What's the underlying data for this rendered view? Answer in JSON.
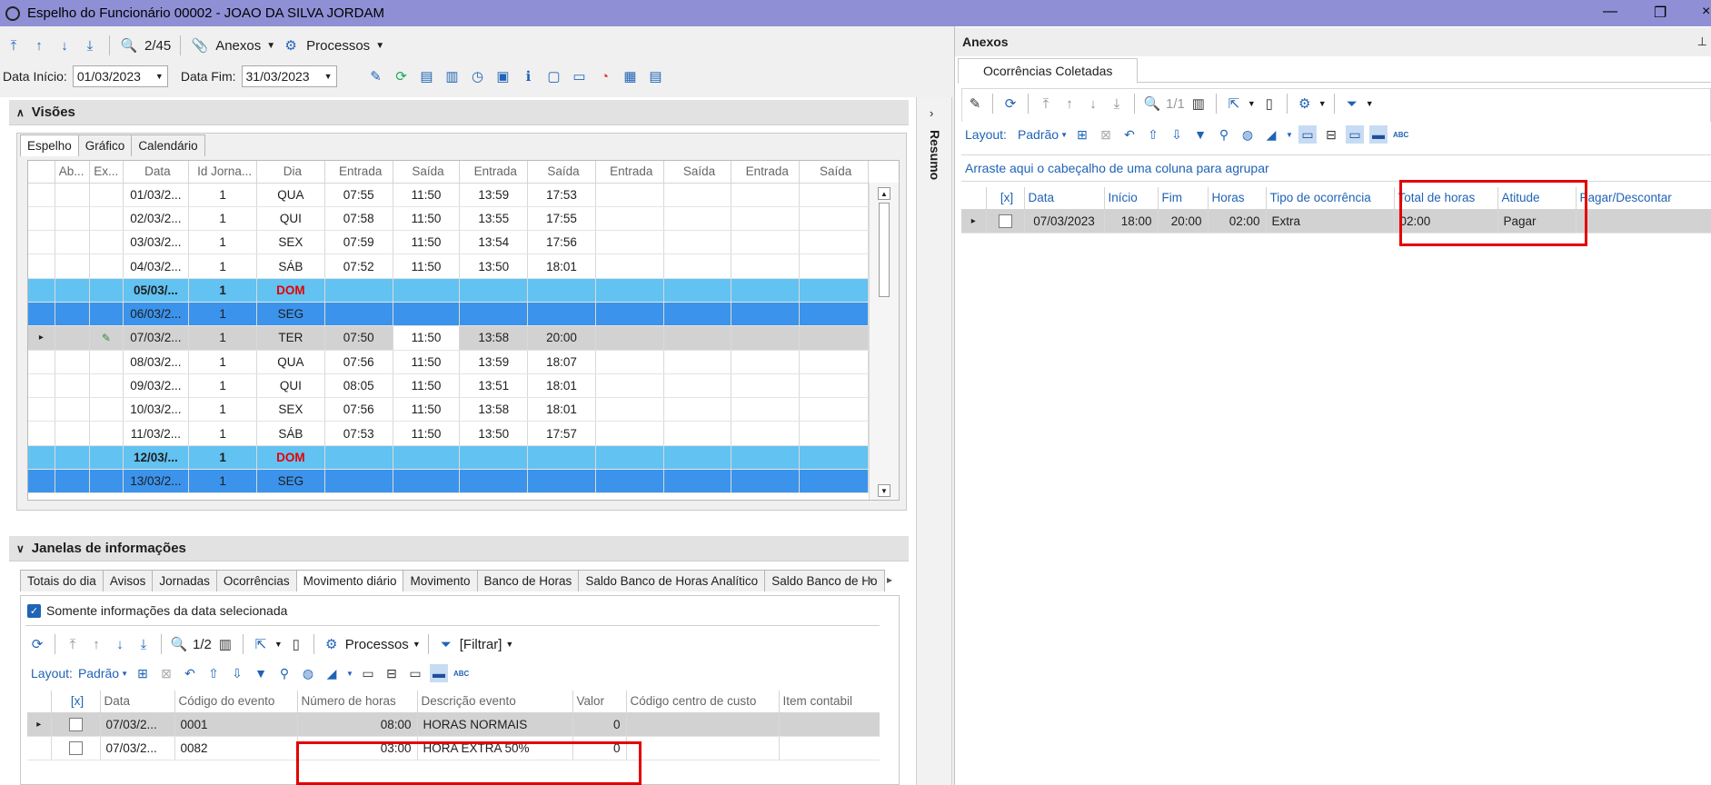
{
  "window": {
    "title": "Espelho do Funcionário 00002 - JOAO DA SILVA JORDAM"
  },
  "toolbar": {
    "counter": "2/45",
    "anexos": "Anexos",
    "processos": "Processos"
  },
  "dates": {
    "inicio_label": "Data Início:",
    "inicio_value": "01/03/2023",
    "fim_label": "Data Fim:",
    "fim_value": "31/03/2023"
  },
  "visoes": {
    "title": "Visões",
    "tabs": [
      "Espelho",
      "Gráfico",
      "Calendário"
    ],
    "columns": [
      "Ab...",
      "Ex...",
      "Data",
      "Id Jorna...",
      "Dia",
      "Entrada",
      "Saída",
      "Entrada",
      "Saída",
      "Entrada",
      "Saída",
      "Entrada",
      "Saída"
    ],
    "rows": [
      {
        "data": "01/03/2...",
        "id": "1",
        "dia": "QUA",
        "e1": "07:55",
        "s1": "11:50",
        "e2": "13:59",
        "s2": "17:53",
        "type": ""
      },
      {
        "data": "02/03/2...",
        "id": "1",
        "dia": "QUI",
        "e1": "07:58",
        "s1": "11:50",
        "e2": "13:55",
        "s2": "17:55",
        "type": ""
      },
      {
        "data": "03/03/2...",
        "id": "1",
        "dia": "SEX",
        "e1": "07:59",
        "s1": "11:50",
        "e2": "13:54",
        "s2": "17:56",
        "type": ""
      },
      {
        "data": "04/03/2...",
        "id": "1",
        "dia": "SÁB",
        "e1": "07:52",
        "s1": "11:50",
        "e2": "13:50",
        "s2": "18:01",
        "type": ""
      },
      {
        "data": "05/03/...",
        "id": "1",
        "dia": "DOM",
        "e1": "",
        "s1": "",
        "e2": "",
        "s2": "",
        "type": "sun"
      },
      {
        "data": "06/03/2...",
        "id": "1",
        "dia": "SEG",
        "e1": "",
        "s1": "",
        "e2": "",
        "s2": "",
        "type": "mon"
      },
      {
        "data": "07/03/2...",
        "id": "1",
        "dia": "TER",
        "e1": "07:50",
        "s1": "11:50",
        "e2": "13:58",
        "s2": "20:00",
        "type": "sel"
      },
      {
        "data": "08/03/2...",
        "id": "1",
        "dia": "QUA",
        "e1": "07:56",
        "s1": "11:50",
        "e2": "13:59",
        "s2": "18:07",
        "type": ""
      },
      {
        "data": "09/03/2...",
        "id": "1",
        "dia": "QUI",
        "e1": "08:05",
        "s1": "11:50",
        "e2": "13:51",
        "s2": "18:01",
        "type": ""
      },
      {
        "data": "10/03/2...",
        "id": "1",
        "dia": "SEX",
        "e1": "07:56",
        "s1": "11:50",
        "e2": "13:58",
        "s2": "18:01",
        "type": ""
      },
      {
        "data": "11/03/2...",
        "id": "1",
        "dia": "SÁB",
        "e1": "07:53",
        "s1": "11:50",
        "e2": "13:50",
        "s2": "17:57",
        "type": ""
      },
      {
        "data": "12/03/...",
        "id": "1",
        "dia": "DOM",
        "e1": "",
        "s1": "",
        "e2": "",
        "s2": "",
        "type": "sun"
      },
      {
        "data": "13/03/2...",
        "id": "1",
        "dia": "SEG",
        "e1": "",
        "s1": "",
        "e2": "",
        "s2": "",
        "type": "mon"
      }
    ]
  },
  "resumo": "Resumo",
  "janelas": {
    "title": "Janelas de informações",
    "tabs": [
      "Totais do dia",
      "Avisos",
      "Jornadas",
      "Ocorrências",
      "Movimento diário",
      "Movimento",
      "Banco de Horas",
      "Saldo Banco de Horas Analítico",
      "Saldo Banco de Ho"
    ],
    "somente": "Somente informações da data selecionada",
    "counter": "1/2",
    "processos": "Processos",
    "filtrar": "[Filtrar]",
    "layout_label": "Layout:",
    "layout_value": "Padrão",
    "columns": [
      "[x]",
      "Data",
      "Código do evento",
      "Número de horas",
      "Descrição evento",
      "Valor",
      "Código centro de custo",
      "Item contabil"
    ],
    "rows": [
      {
        "data": "07/03/2...",
        "codigo": "0001",
        "horas": "08:00",
        "desc": "HORAS NORMAIS",
        "valor": "0"
      },
      {
        "data": "07/03/2...",
        "codigo": "0082",
        "horas": "03:00",
        "desc": "HORA EXTRA 50%",
        "valor": "0"
      }
    ]
  },
  "anexos": {
    "title": "Anexos",
    "tab": "Ocorrências Coletadas",
    "counter": "1/1",
    "layout_label": "Layout:",
    "layout_value": "Padrão",
    "group_hint": "Arraste aqui o cabeçalho de uma coluna para agrupar",
    "columns": [
      "[x]",
      "Data",
      "Início",
      "Fim",
      "Horas",
      "Tipo de ocorrência",
      "Total de horas",
      "Atitude",
      "Pagar/Descontar"
    ],
    "row": {
      "data": "07/03/2023",
      "inicio": "18:00",
      "fim": "20:00",
      "horas": "02:00",
      "tipo": "Extra",
      "total": "02:00",
      "atitude": "Pagar",
      "pagar": ""
    }
  }
}
